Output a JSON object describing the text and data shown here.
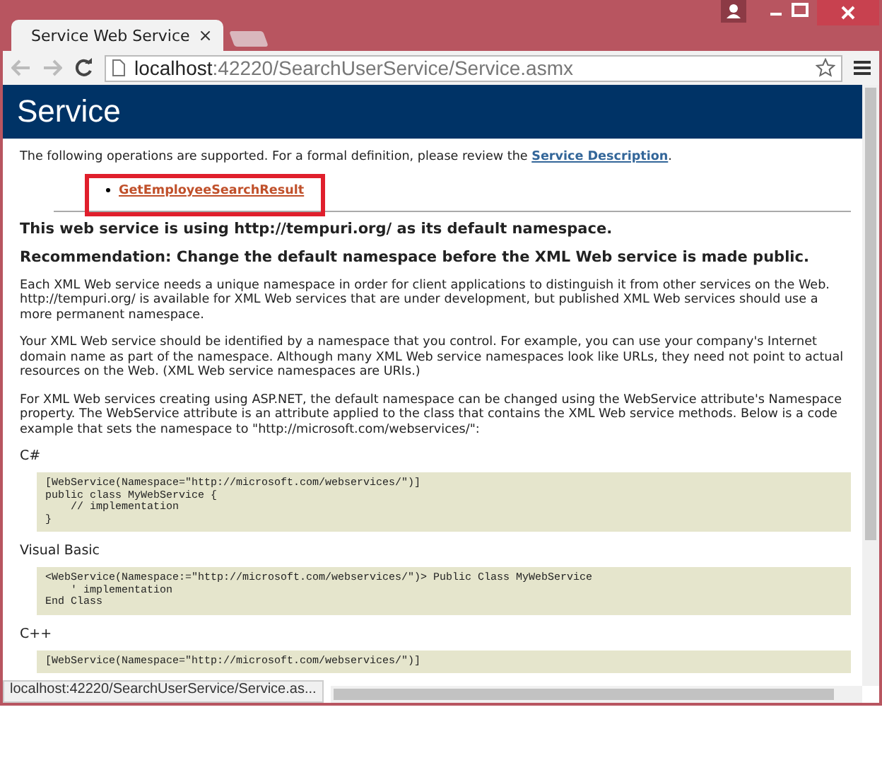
{
  "tab": {
    "title": "Service Web Service",
    "close": "×"
  },
  "address": {
    "host": "localhost",
    "path": ":42220/SearchUserService/Service.asmx"
  },
  "header": "Service",
  "intro": {
    "text": "The following operations are supported. For a formal definition, please review the ",
    "link": "Service Description",
    "tail": "."
  },
  "operations": [
    {
      "name": "GetEmployeeSearchResult",
      "highlighted": true
    }
  ],
  "headings": [
    "This web service is using http://tempuri.org/ as its default namespace.",
    "Recommendation: Change the default namespace before the XML Web service is made public."
  ],
  "paragraphs": [
    "Each XML Web service needs a unique namespace in order for client applications to distinguish it from other services on the Web. http://tempuri.org/ is available for XML Web services that are under development, but published XML Web services should use a more permanent namespace.",
    "Your XML Web service should be identified by a namespace that you control. For example, you can use your company's Internet domain name as part of the namespace. Although many XML Web service namespaces look like URLs, they need not point to actual resources on the Web. (XML Web service namespaces are URIs.)",
    "For XML Web services creating using ASP.NET, the default namespace can be changed using the WebService attribute's Namespace property. The WebService attribute is an attribute applied to the class that contains the XML Web service methods. Below is a code example that sets the namespace to \"http://microsoft.com/webservices/\":"
  ],
  "examples": [
    {
      "language": "C#",
      "code": "[WebService(Namespace=\"http://microsoft.com/webservices/\")]\npublic class MyWebService {\n    // implementation\n}"
    },
    {
      "language": "Visual Basic",
      "code": "<WebService(Namespace:=\"http://microsoft.com/webservices/\")> Public Class MyWebService\n    ' implementation\nEnd Class"
    },
    {
      "language": "C++",
      "code": "[WebService(Namespace=\"http://microsoft.com/webservices/\")]"
    }
  ],
  "status_bar": "localhost:42220/SearchUserService/Service.as..."
}
